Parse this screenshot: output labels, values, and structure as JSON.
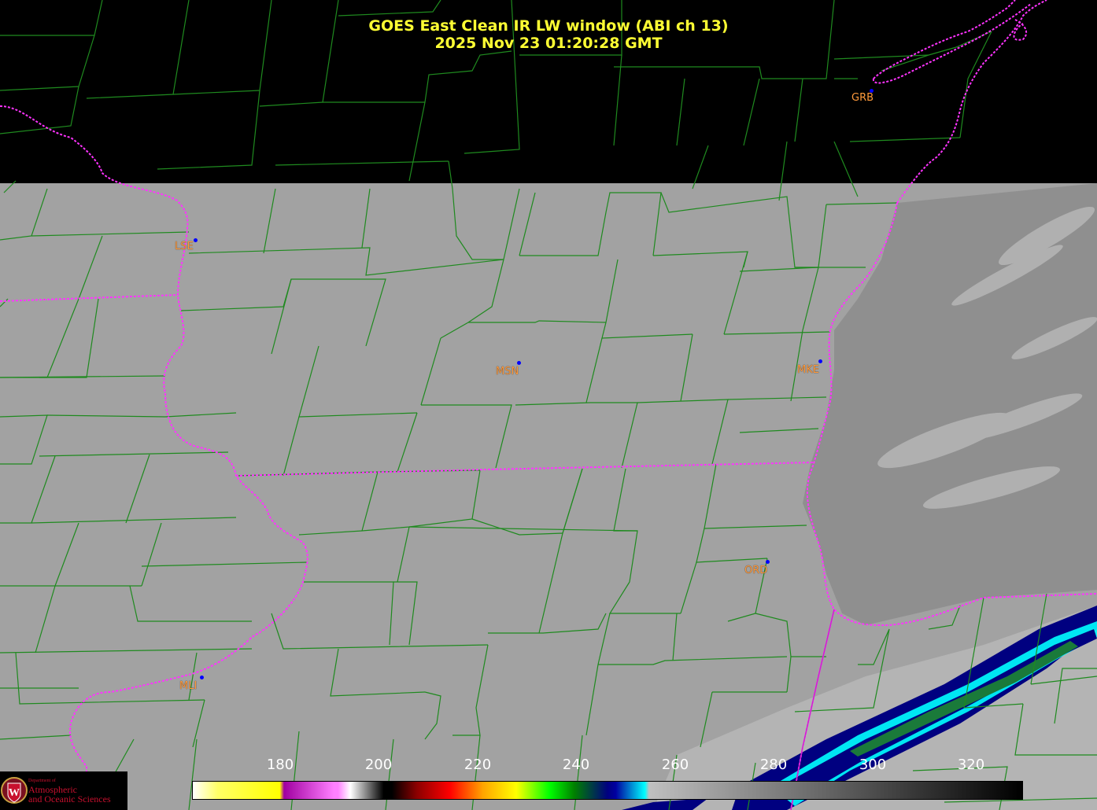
{
  "title": {
    "line1": "GOES East Clean IR LW window (ABI ch 13)",
    "line2": "2025 Nov 23  01:20:28 GMT"
  },
  "stations": [
    {
      "id": "GRB"
    },
    {
      "id": "LSE"
    },
    {
      "id": "MSN"
    },
    {
      "id": "MKE"
    },
    {
      "id": "ORD"
    },
    {
      "id": "MLI"
    }
  ],
  "colorbar": {
    "ticks": [
      "180",
      "200",
      "220",
      "240",
      "260",
      "280",
      "300",
      "320"
    ],
    "stops": [
      "#ffffff",
      "#ffff00",
      "#a000a0",
      "#ff80ff",
      "#ffffff",
      "#000000",
      "#8b0000",
      "#ff0000",
      "#ffa500",
      "#ffff00",
      "#00ff00",
      "#008000",
      "#000080",
      "#00ffff",
      "#c0c0c0",
      "#000000"
    ]
  },
  "logo": {
    "line1": "Department of",
    "line2": "Atmospheric",
    "line3": "and Oceanic Sciences",
    "emblem": "W"
  },
  "colors": {
    "county_lines": "#1f8a1f",
    "state_lines": "#ff33ff",
    "title": "#ffff33",
    "station_label": "#ff9a3c"
  }
}
